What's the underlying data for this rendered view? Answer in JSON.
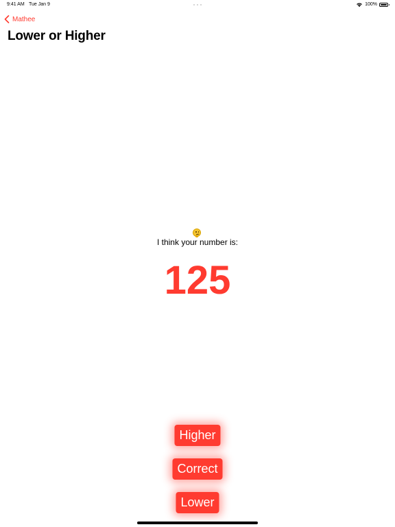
{
  "status_bar": {
    "time": "9:41 AM",
    "date": "Tue Jan 9",
    "battery_percent": "100%",
    "battery_level": 1.0
  },
  "navigation": {
    "back_label": "Mathee",
    "title": "Lower or Higher"
  },
  "game": {
    "emoji": "thinking-face",
    "prompt": "I think your number is:",
    "guess": "125"
  },
  "buttons": {
    "higher": "Higher",
    "correct": "Correct",
    "lower": "Lower"
  },
  "colors": {
    "accent": "#ff3b30",
    "background": "#ffffff",
    "text": "#000000"
  }
}
